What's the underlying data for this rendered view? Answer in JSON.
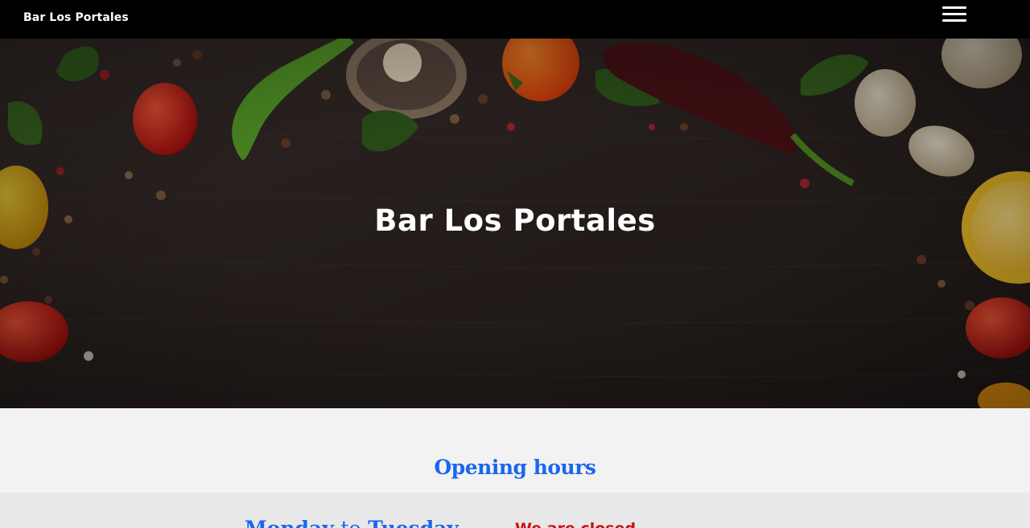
{
  "navbar": {
    "brand": "Bar Los Portales",
    "menu_icon": "hamburger-menu-icon"
  },
  "hero": {
    "title": "Bar Los Portales",
    "background_image": "dark-wood-vegetables-photo"
  },
  "opening_hours": {
    "title": "Opening hours",
    "rows": [
      {
        "day_from": "Monday",
        "connector": "to",
        "day_to": "Tuesday",
        "status": "We are closed"
      }
    ]
  },
  "colors": {
    "nav_background": "#000000",
    "accent_blue": "#1a66f0",
    "closed_red": "#cc1111",
    "section_background": "#f2f2f2"
  }
}
